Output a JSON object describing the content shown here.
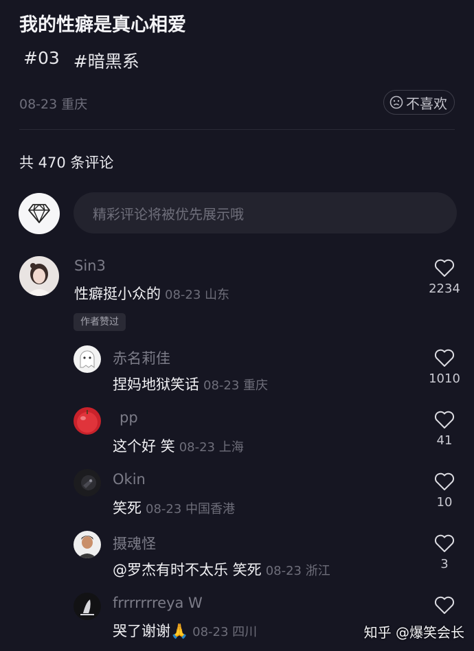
{
  "post": {
    "title": "我的性癖是真心相爱",
    "tags": [
      "#03",
      "#暗黑系"
    ],
    "meta": "08-23 重庆",
    "dislike_label": "不喜欢",
    "dislike_icon": "sad-face-icon"
  },
  "comments_header": {
    "count_text": "共 470 条评论"
  },
  "comment_box": {
    "placeholder": "精彩评论将被优先展示哦",
    "avatar_icon": "diamond-icon"
  },
  "comments": [
    {
      "username": "Sin3",
      "text": "性癖挺小众的",
      "time_location": "08-23 山东",
      "likes": "2234",
      "badge": "作者赞过",
      "avatar_icon": "avatar-girl"
    },
    {
      "username": "赤名莉佳",
      "text": "捏妈地狱笑话",
      "time_location": "08-23 重庆",
      "likes": "1010",
      "avatar_icon": "avatar-ghost"
    },
    {
      "username": "pp",
      "text": "这个好 笑",
      "time_location": "08-23 上海",
      "likes": "41",
      "avatar_icon": "avatar-apple"
    },
    {
      "username": "Okin",
      "text": "笑死",
      "time_location": "08-23 中国香港",
      "likes": "10",
      "avatar_icon": "avatar-dark"
    },
    {
      "username": "摄魂怪",
      "text": "@罗杰有时不太乐 笑死",
      "time_location": "08-23 浙江",
      "likes": "3",
      "avatar_icon": "avatar-man"
    },
    {
      "username": "frrrrrrreya W",
      "text": "哭了谢谢🙏",
      "time_location": "08-23 四川",
      "likes": "",
      "avatar_icon": "avatar-sketch"
    }
  ],
  "watermark": "知乎 @爆笑会长",
  "colors": {
    "background": "#161622",
    "text_primary": "#f1f1f4",
    "text_secondary": "#6e6e7a"
  }
}
